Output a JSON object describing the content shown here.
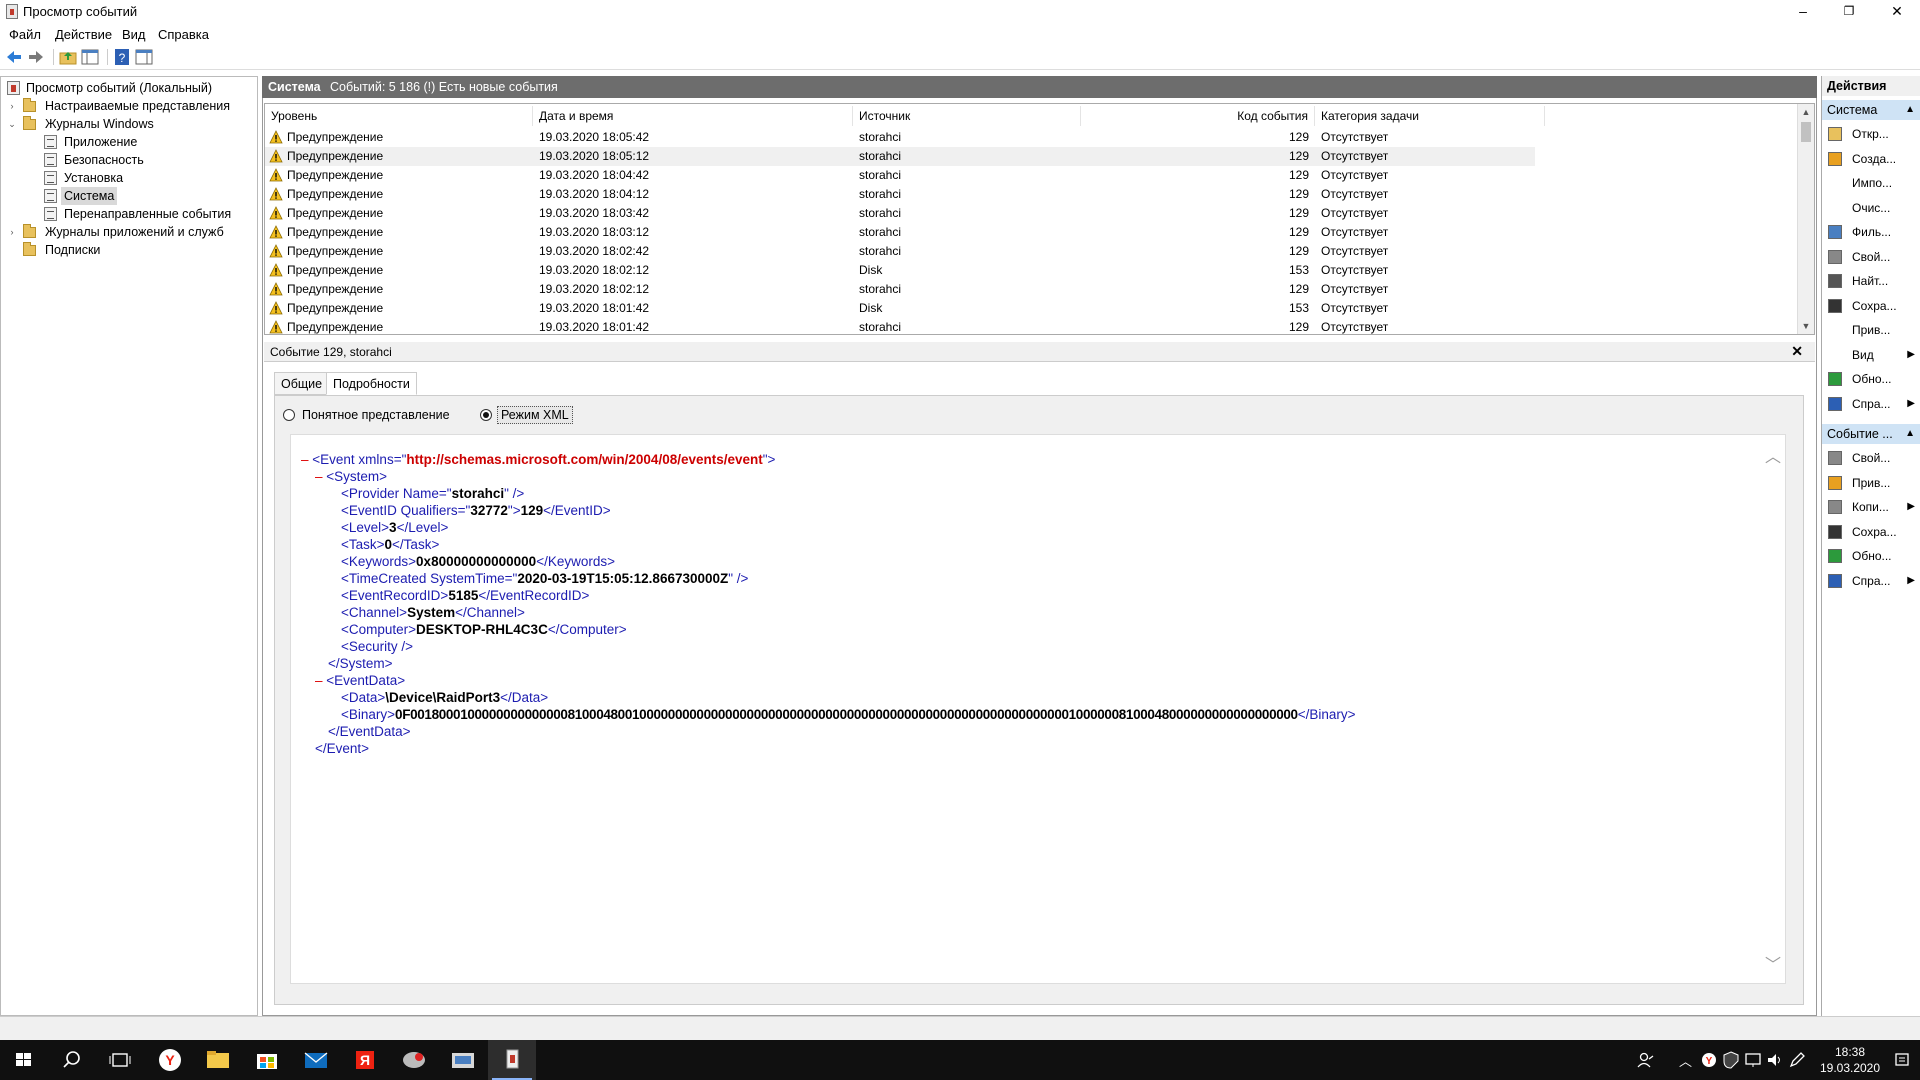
{
  "window": {
    "title": "Просмотр событий",
    "minimize_label": "–",
    "restore_label": "❐",
    "close_label": "✕"
  },
  "menu": [
    "Файл",
    "Действие",
    "Вид",
    "Справка"
  ],
  "tree": {
    "root": "Просмотр событий (Локальный)",
    "custom_views": "Настраиваемые представления",
    "windows_logs": "Журналы Windows",
    "application": "Приложение",
    "security": "Безопасность",
    "setup": "Установка",
    "system": "Система",
    "forwarded": "Перенаправленные события",
    "app_services": "Журналы приложений и служб",
    "subscriptions": "Подписки"
  },
  "log_header": {
    "name": "Система",
    "summary": "Событий: 5 186 (!) Есть новые события"
  },
  "grid": {
    "columns": [
      "Уровень",
      "Дата и время",
      "Источник",
      "Код события",
      "Категория задачи"
    ],
    "rows": [
      [
        "Предупреждение",
        "19.03.2020 18:05:42",
        "storahci",
        "129",
        "Отсутствует"
      ],
      [
        "Предупреждение",
        "19.03.2020 18:05:12",
        "storahci",
        "129",
        "Отсутствует"
      ],
      [
        "Предупреждение",
        "19.03.2020 18:04:42",
        "storahci",
        "129",
        "Отсутствует"
      ],
      [
        "Предупреждение",
        "19.03.2020 18:04:12",
        "storahci",
        "129",
        "Отсутствует"
      ],
      [
        "Предупреждение",
        "19.03.2020 18:03:42",
        "storahci",
        "129",
        "Отсутствует"
      ],
      [
        "Предупреждение",
        "19.03.2020 18:03:12",
        "storahci",
        "129",
        "Отсутствует"
      ],
      [
        "Предупреждение",
        "19.03.2020 18:02:42",
        "storahci",
        "129",
        "Отсутствует"
      ],
      [
        "Предупреждение",
        "19.03.2020 18:02:12",
        "Disk",
        "153",
        "Отсутствует"
      ],
      [
        "Предупреждение",
        "19.03.2020 18:02:12",
        "storahci",
        "129",
        "Отсутствует"
      ],
      [
        "Предупреждение",
        "19.03.2020 18:01:42",
        "Disk",
        "153",
        "Отсутствует"
      ],
      [
        "Предупреждение",
        "19.03.2020 18:01:42",
        "storahci",
        "129",
        "Отсутствует"
      ]
    ]
  },
  "details": {
    "title": "Событие 129, storahci",
    "close": "✕",
    "tabs": [
      "Общие",
      "Подробности"
    ],
    "radio_friendly": "Понятное представление",
    "radio_xml": "Режим XML"
  },
  "xml": {
    "minus": "–",
    "event_open": "<Event xmlns=\"",
    "event_ns": "http://schemas.microsoft.com/win/2004/08/events/event",
    "event_open_end": "\">",
    "system_open": "<System>",
    "provider_open": "<Provider Name=\"",
    "provider_name": "storahci",
    "provider_close": "\" />",
    "eventid_open": "<EventID Qualifiers=\"",
    "eventid_qual": "32772",
    "eventid_mid": "\">",
    "eventid_val": "129",
    "eventid_close": "</EventID>",
    "level_open": "<Level>",
    "level_val": "3",
    "level_close": "</Level>",
    "task_open": "<Task>",
    "task_val": "0",
    "task_close": "</Task>",
    "keywords_open": "<Keywords>",
    "keywords_val": "0x80000000000000",
    "keywords_close": "</Keywords>",
    "timecreated_open": "<TimeCreated SystemTime=\"",
    "timecreated_val": "2020-03-19T15:05:12.866730000Z",
    "timecreated_close": "\" />",
    "recordid_open": "<EventRecordID>",
    "recordid_val": "5185",
    "recordid_close": "</EventRecordID>",
    "channel_open": "<Channel>",
    "channel_val": "System",
    "channel_close": "</Channel>",
    "computer_open": "<Computer>",
    "computer_val": "DESKTOP-RHL4C3C",
    "computer_close": "</Computer>",
    "security": "<Security />",
    "system_close": "</System>",
    "eventdata_open": "<EventData>",
    "data_open": "<Data>",
    "data_val": "\\Device\\RaidPort3",
    "data_close": "</Data>",
    "binary_open": "<Binary>",
    "binary_val": "0F0018000100000000000000810004800100000000000000000000000000000000000000000000000000000000000010000008100048000000000000000000",
    "binary_close": "</Binary>",
    "eventdata_close": "</EventData>",
    "event_close": "</Event>"
  },
  "actions": {
    "header": "Действия",
    "section1": "Система",
    "section1_items": [
      "Откр...",
      "Созда...",
      "Импо...",
      "Очис...",
      "Филь...",
      "Свой...",
      "Найт...",
      "Сохра...",
      "Прив...",
      "Вид",
      "Обно...",
      "Спра..."
    ],
    "section2": "Событие ...",
    "section2_items": [
      "Свой...",
      "Прив...",
      "Копи...",
      "Сохра...",
      "Обно...",
      "Спра..."
    ]
  },
  "taskbar": {
    "time": "18:38",
    "date": "19.03.2020"
  },
  "colors": {
    "header_bar": "#6d6d6d",
    "xml_tag": "#1c1cb0",
    "xml_url": "#cc0000",
    "action_section": "#cfe3f5",
    "taskbar": "#101010"
  }
}
